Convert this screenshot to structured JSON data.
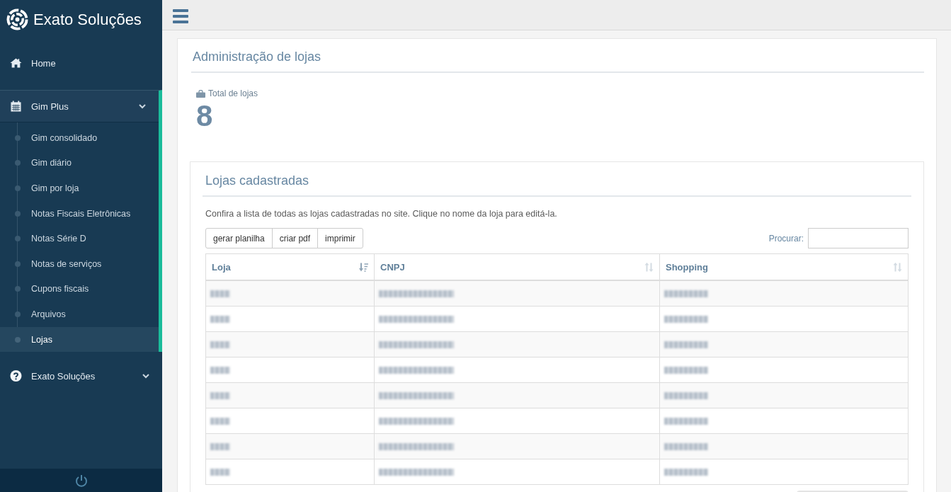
{
  "brand": {
    "name": "Exato Soluções"
  },
  "sidebar": {
    "items": [
      {
        "label": "Home",
        "kind": "link",
        "selected": false
      },
      {
        "label": "Gim Plus",
        "kind": "group",
        "selected": true,
        "expanded": true,
        "children": [
          {
            "label": "Gim consolidado",
            "selected": false
          },
          {
            "label": "Gim diário",
            "selected": false
          },
          {
            "label": "Gim por loja",
            "selected": false
          },
          {
            "label": "Notas Fiscais Eletrônicas",
            "selected": false
          },
          {
            "label": "Notas Série D",
            "selected": false
          },
          {
            "label": "Notas de serviços",
            "selected": false
          },
          {
            "label": "Cupons fiscais",
            "selected": false
          },
          {
            "label": "Arquivos",
            "selected": false
          },
          {
            "label": "Lojas",
            "selected": true
          }
        ]
      },
      {
        "label": "Exato Soluções",
        "kind": "group",
        "selected": false,
        "expanded": false
      }
    ]
  },
  "page": {
    "title": "Administração de lojas",
    "stat": {
      "label": "Total de lojas",
      "value": "8"
    }
  },
  "card": {
    "title": "Lojas cadastradas",
    "description": "Confira a lista de todas as lojas cadastradas no site. Clique no nome da loja para editá-la.",
    "buttons": [
      "gerar planilha",
      "criar pdf",
      "imprimir"
    ],
    "search": {
      "label": "Procurar:"
    },
    "table": {
      "columns": [
        {
          "label": "Loja",
          "sorted": true
        },
        {
          "label": "CNPJ",
          "sorted": false
        },
        {
          "label": "Shopping",
          "sorted": false
        }
      ],
      "rows": [
        {
          "cells": [
            {
              "blurred": true
            },
            {
              "blurred": true
            },
            {
              "blurred": true
            }
          ]
        },
        {
          "cells": [
            {
              "blurred": true
            },
            {
              "blurred": true
            },
            {
              "blurred": true
            }
          ]
        },
        {
          "cells": [
            {
              "blurred": true
            },
            {
              "blurred": true
            },
            {
              "blurred": true
            }
          ]
        },
        {
          "cells": [
            {
              "blurred": true
            },
            {
              "blurred": true
            },
            {
              "blurred": true
            }
          ]
        },
        {
          "cells": [
            {
              "blurred": true
            },
            {
              "blurred": true
            },
            {
              "blurred": true
            }
          ]
        },
        {
          "cells": [
            {
              "blurred": true
            },
            {
              "blurred": true
            },
            {
              "blurred": true
            }
          ]
        },
        {
          "cells": [
            {
              "blurred": true
            },
            {
              "blurred": true
            },
            {
              "blurred": true
            }
          ]
        },
        {
          "cells": [
            {
              "blurred": true
            },
            {
              "blurred": true
            },
            {
              "blurred": true
            }
          ]
        }
      ]
    }
  }
}
